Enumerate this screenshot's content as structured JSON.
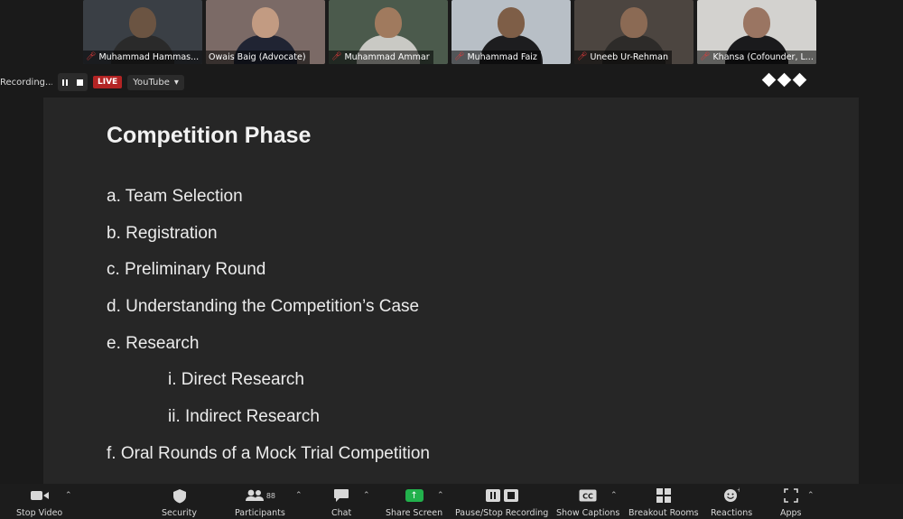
{
  "participants": [
    {
      "name": "Muhammad Hammas...",
      "muted": true,
      "bg": "#3a3f45",
      "skin": "#6b5442",
      "cloth": "#2a2a2a"
    },
    {
      "name": "Owais Baig (Advocate)",
      "muted": false,
      "bg": "#7b6a66",
      "skin": "#c29b82",
      "cloth": "#202433"
    },
    {
      "name": "Muhammad Ammar",
      "muted": true,
      "bg": "#4b5a4c",
      "skin": "#a07a5e",
      "cloth": "#c9c9c4"
    },
    {
      "name": "Muhammad Faiz",
      "muted": true,
      "bg": "#b8bfc6",
      "skin": "#7e5e47",
      "cloth": "#1d1d1f"
    },
    {
      "name": "Uneeb Ur-Rehman",
      "muted": true,
      "bg": "#4c4540",
      "skin": "#8b6a54",
      "cloth": "#2d2b29"
    },
    {
      "name": "Khansa (Cofounder, L...",
      "muted": true,
      "bg": "#d3d2cf",
      "skin": "#9a7562",
      "cloth": "#1a1a1c"
    }
  ],
  "recording": {
    "status_text": "Recording...",
    "live_label": "LIVE",
    "stream_label": "YouTube"
  },
  "slide": {
    "title": "Competition Phase",
    "items": [
      {
        "text": "a. Team Selection",
        "level": 0
      },
      {
        "text": "b. Registration",
        "level": 0
      },
      {
        "text": "c. Preliminary Round",
        "level": 0
      },
      {
        "text": "d. Understanding the Competition’s Case",
        "level": 0
      },
      {
        "text": "e. Research",
        "level": 0
      },
      {
        "text": "i. Direct Research",
        "level": 1
      },
      {
        "text": "ii. Indirect Research",
        "level": 1
      },
      {
        "text": "f. Oral Rounds of a Mock Trial Competition",
        "level": 0
      }
    ]
  },
  "toolbar": {
    "stop_video": "Stop Video",
    "security": "Security",
    "participants": "Participants",
    "participants_count": "88",
    "chat": "Chat",
    "share_screen": "Share Screen",
    "pause_stop_recording": "Pause/Stop Recording",
    "show_captions": "Show Captions",
    "breakout_rooms": "Breakout Rooms",
    "reactions": "Reactions",
    "apps": "Apps"
  },
  "colors": {
    "live": "#b32424",
    "share_green": "#22b14c",
    "mic_off": "#e03b3b"
  }
}
